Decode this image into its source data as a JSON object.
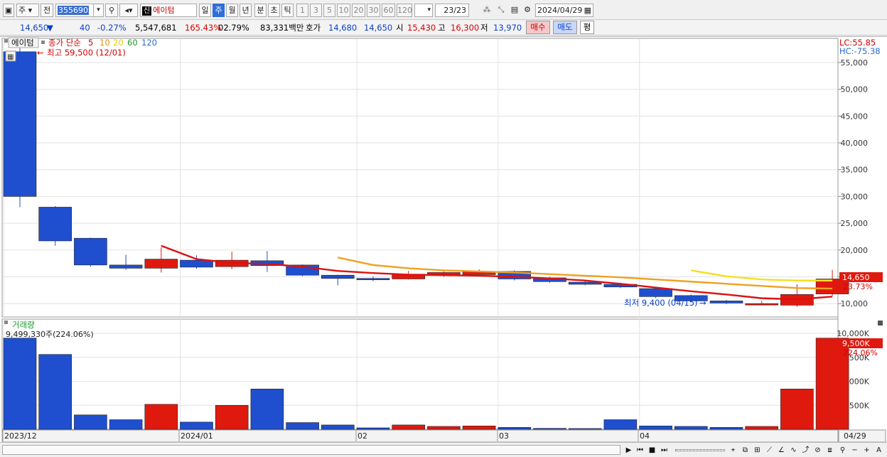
{
  "toolbar": {
    "period_type": "주",
    "jeon_label": "전",
    "code": "355690",
    "sin_badge": "신",
    "stock_name": "에이텀",
    "periods": [
      "일",
      "주",
      "월",
      "년",
      "분",
      "초",
      "틱"
    ],
    "selected_period": "주",
    "numbers": [
      "1",
      "3",
      "5",
      "10",
      "20",
      "30",
      "60",
      "120"
    ],
    "page_indicator": "23/23",
    "date": "2024/04/29"
  },
  "quote": {
    "price": "14,650",
    "change_arrow": "▼",
    "change": "40",
    "change_pct": "-0.27%",
    "volume": "5,547,681",
    "vol_ratio": "165.43%",
    "turnover": "02.79%",
    "amount": "83,331백만",
    "hoga_label": "호가",
    "ask": "14,680",
    "bid": "14,650",
    "open_label": "시",
    "open": "15,430",
    "high_label": "고",
    "high": "16,300",
    "low_label": "저",
    "low": "13,970",
    "buy_label": "매수",
    "sell_label": "매도",
    "avg_label": "평"
  },
  "legend": {
    "stock": "에이텀",
    "ma_prefix": "종가 단순",
    "ma_periods": [
      "5",
      "10",
      "20",
      "60",
      "120"
    ],
    "high_marker": "최고 59,500 (12/01)",
    "low_marker": "최저 9,400 (04/15)",
    "lc": "LC:55.85",
    "hc": "HC:-75.38",
    "last_price_tag": "14,650",
    "last_pct_tag": "23.73%",
    "volume_title": "거래량",
    "volume_info": "9,499,330주(224.06%)",
    "last_vol_tag": "9,500K",
    "last_vol_pct": "224.06%"
  },
  "colors": {
    "up": "#e0190f",
    "down": "#1f4fcf",
    "ma5": "#dd1111",
    "ma10": "#f0a020",
    "ma20": "#f4e020",
    "ma60": "#1a9a2a",
    "ma120": "#2a6ad0"
  },
  "x_labels": [
    "2023/12",
    "2024/01",
    "02",
    "03",
    "04",
    "04/29"
  ],
  "chart_data": {
    "type": "candlestick",
    "title": "",
    "y_ticks": [
      "55,000",
      "50,000",
      "45,000",
      "40,000",
      "35,000",
      "30,000",
      "25,000",
      "20,000",
      "15,000",
      "10,000"
    ],
    "ylim": [
      7500,
      59500
    ],
    "volume_ticks": [
      "10,000K",
      "7,500K",
      "5,000K",
      "2,500K"
    ],
    "volume_ylim": [
      0,
      10000
    ],
    "candles": [
      {
        "o": 57000,
        "c": 30000,
        "h": 59500,
        "l": 28000,
        "v": 9500
      },
      {
        "o": 28000,
        "c": 21700,
        "h": 28200,
        "l": 20800,
        "v": 7800
      },
      {
        "o": 22200,
        "c": 17200,
        "h": 22300,
        "l": 16900,
        "v": 1500
      },
      {
        "o": 17200,
        "c": 16600,
        "h": 19100,
        "l": 16300,
        "v": 1000
      },
      {
        "o": 16600,
        "c": 18300,
        "h": 20500,
        "l": 15800,
        "v": 2600
      },
      {
        "o": 18100,
        "c": 16800,
        "h": 19000,
        "l": 16500,
        "v": 750
      },
      {
        "o": 16900,
        "c": 18100,
        "h": 19700,
        "l": 16400,
        "v": 2500
      },
      {
        "o": 18000,
        "c": 17100,
        "h": 19800,
        "l": 15900,
        "v": 4200
      },
      {
        "o": 17200,
        "c": 15300,
        "h": 17300,
        "l": 15100,
        "v": 700
      },
      {
        "o": 15300,
        "c": 14700,
        "h": 15400,
        "l": 13400,
        "v": 450
      },
      {
        "o": 14700,
        "c": 14500,
        "h": 15100,
        "l": 14200,
        "v": 150
      },
      {
        "o": 14600,
        "c": 15500,
        "h": 16100,
        "l": 14500,
        "v": 450
      },
      {
        "o": 15300,
        "c": 15800,
        "h": 16200,
        "l": 15000,
        "v": 300
      },
      {
        "o": 15400,
        "c": 16000,
        "h": 16400,
        "l": 15200,
        "v": 350
      },
      {
        "o": 16000,
        "c": 14600,
        "h": 16200,
        "l": 14300,
        "v": 200
      },
      {
        "o": 14800,
        "c": 14100,
        "h": 15000,
        "l": 13900,
        "v": 100
      },
      {
        "o": 14000,
        "c": 13600,
        "h": 14300,
        "l": 13400,
        "v": 80
      },
      {
        "o": 13600,
        "c": 13100,
        "h": 13900,
        "l": 12900,
        "v": 1000
      },
      {
        "o": 12800,
        "c": 11300,
        "h": 13000,
        "l": 11000,
        "v": 350
      },
      {
        "o": 11500,
        "c": 10500,
        "h": 11700,
        "l": 10300,
        "v": 300
      },
      {
        "o": 10500,
        "c": 10100,
        "h": 10700,
        "l": 9900,
        "v": 200
      },
      {
        "o": 10000,
        "c": 10000,
        "h": 10500,
        "l": 9800,
        "v": 300
      },
      {
        "o": 9700,
        "c": 11700,
        "h": 13600,
        "l": 9400,
        "v": 4200
      },
      {
        "o": 11800,
        "c": 14600,
        "h": 16300,
        "l": 11400,
        "v": 9500
      }
    ],
    "ma5": [
      null,
      null,
      null,
      null,
      20800,
      18300,
      17600,
      17400,
      16900,
      16100,
      15700,
      15400,
      15300,
      15200,
      15000,
      14700,
      14300,
      13700,
      13000,
      12300,
      11700,
      11000,
      10800,
      11300
    ],
    "ma10": [
      null,
      null,
      null,
      null,
      null,
      null,
      null,
      null,
      null,
      18600,
      17200,
      16600,
      16200,
      16000,
      15800,
      15500,
      15200,
      14900,
      14500,
      14100,
      13700,
      13300,
      12900,
      12800
    ],
    "ma20": [
      null,
      null,
      null,
      null,
      null,
      null,
      null,
      null,
      null,
      null,
      null,
      null,
      null,
      null,
      null,
      null,
      null,
      null,
      null,
      16200,
      15100,
      14500,
      14300,
      14300
    ]
  }
}
